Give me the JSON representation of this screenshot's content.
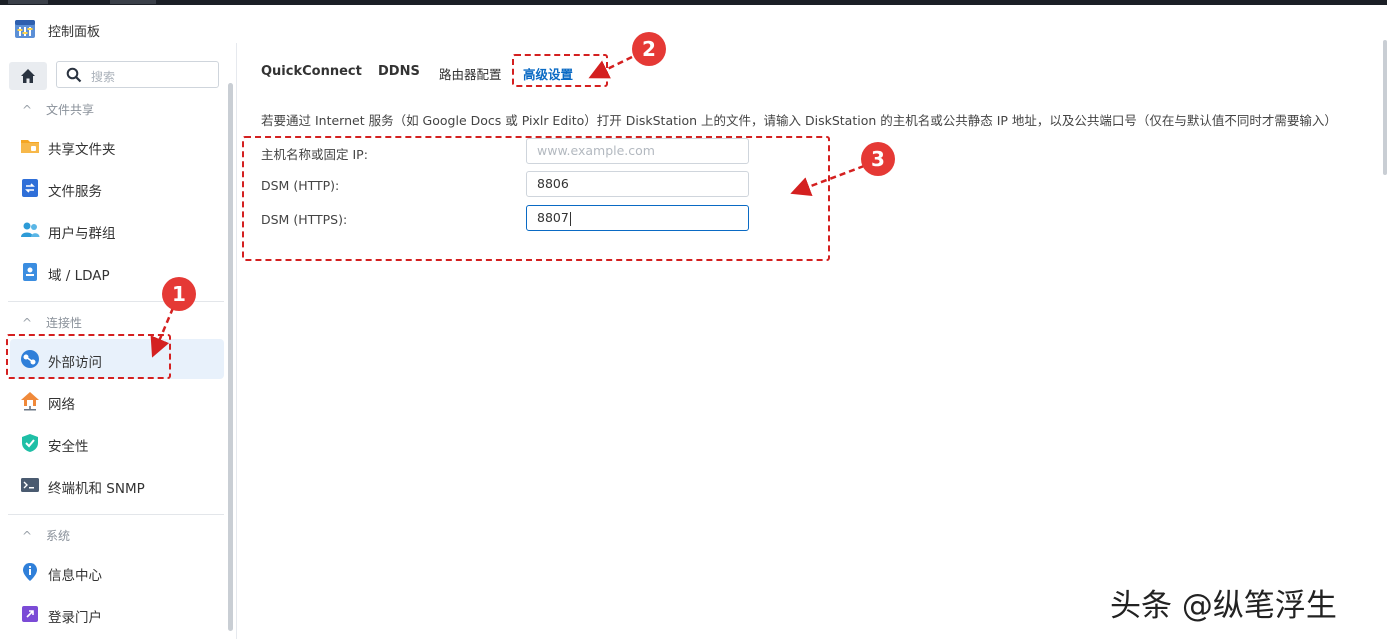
{
  "window": {
    "title": "控制面板"
  },
  "sidebar": {
    "search": {
      "placeholder": "搜索"
    },
    "sections": [
      {
        "label": "文件共享",
        "items": [
          "共享文件夹",
          "文件服务",
          "用户与群组",
          "域 / LDAP"
        ]
      },
      {
        "label": "连接性",
        "items": [
          "外部访问",
          "网络",
          "安全性",
          "终端机和 SNMP"
        ]
      },
      {
        "label": "系统",
        "items": [
          "信息中心",
          "登录门户"
        ]
      }
    ],
    "active_item": "外部访问"
  },
  "tabs": [
    {
      "label": "QuickConnect"
    },
    {
      "label": "DDNS"
    },
    {
      "label": "路由器配置"
    },
    {
      "label": "高级设置"
    }
  ],
  "active_tab": "高级设置",
  "description": "若要通过 Internet 服务（如 Google Docs 或 Pixlr Edito）打开 DiskStation 上的文件，请输入 DiskStation 的主机名或公共静态 IP 地址，以及公共端口号（仅在与默认值不同时才需要输入）",
  "form": {
    "hostname": {
      "label": "主机名称或固定 IP:",
      "value": "",
      "placeholder": "www.example.com"
    },
    "http": {
      "label": "DSM (HTTP):",
      "value": "8806"
    },
    "https": {
      "label": "DSM (HTTPS):",
      "value": "8807"
    }
  },
  "annotations": [
    "1",
    "2",
    "3"
  ],
  "watermark": "头条 @纵笔浮生",
  "colors": {
    "accent": "#0a6ac4",
    "annotation": "#d42020",
    "active_bg": "#e8f1fb"
  }
}
